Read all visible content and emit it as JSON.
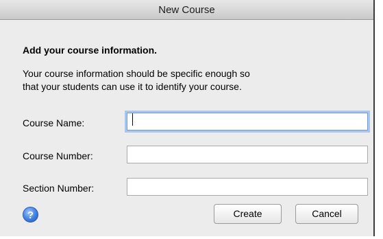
{
  "window": {
    "title": "New Course"
  },
  "form": {
    "heading": "Add your course information.",
    "description_line1": "Your course information should be specific enough so",
    "description_line2": "that your students can use it to identify your course.",
    "fields": [
      {
        "label": "Course Name:",
        "value": ""
      },
      {
        "label": "Course Number:",
        "value": ""
      },
      {
        "label": "Section Number:",
        "value": ""
      }
    ]
  },
  "buttons": {
    "help": "?",
    "create": "Create",
    "cancel": "Cancel"
  }
}
